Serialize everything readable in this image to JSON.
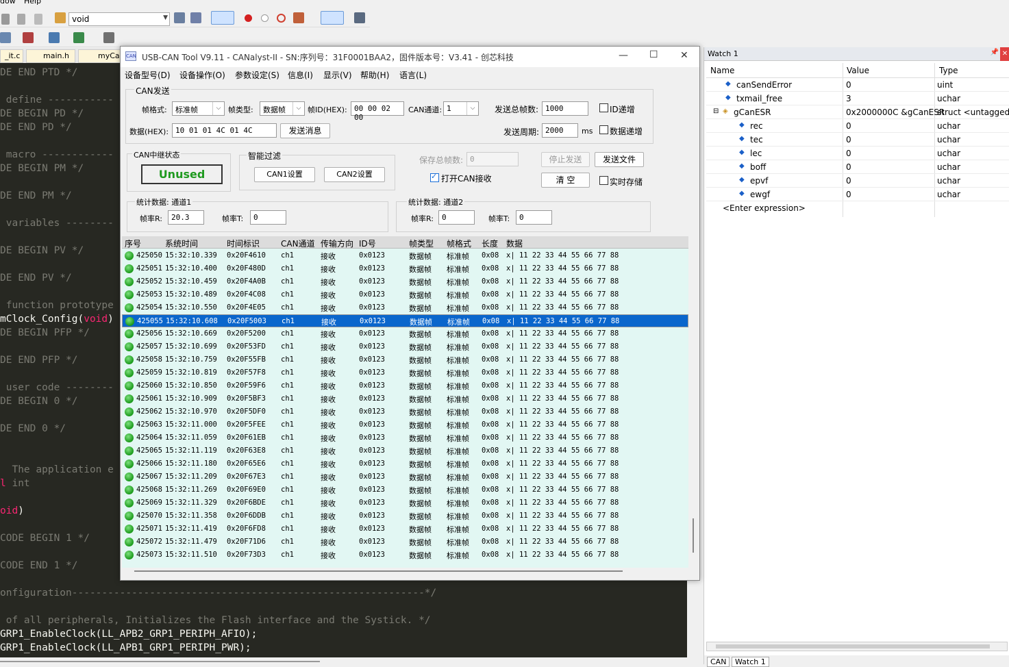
{
  "ide": {
    "menu": [
      "dow",
      "Help"
    ],
    "target_combo": "void",
    "file_tabs": [
      "_it.c",
      "main.h",
      "myCan"
    ],
    "code_lines": [
      {
        "text": "DE END PTD */",
        "hl": false
      },
      {
        "text": "",
        "hl": false
      },
      {
        "text": " define -----------",
        "hl": false
      },
      {
        "text": "DE BEGIN PD */",
        "hl": false
      },
      {
        "text": "DE END PD */",
        "hl": false
      },
      {
        "text": "",
        "hl": false
      },
      {
        "text": " macro ------------",
        "hl": false
      },
      {
        "text": "DE BEGIN PM */",
        "hl": false
      },
      {
        "text": "",
        "hl": false
      },
      {
        "text": "DE END PM */",
        "hl": false
      },
      {
        "text": "",
        "hl": false
      },
      {
        "text": " variables --------",
        "hl": false
      },
      {
        "text": "",
        "hl": false
      },
      {
        "text": "DE BEGIN PV */",
        "hl": false
      },
      {
        "text": "",
        "hl": false
      },
      {
        "text": "DE END PV */",
        "hl": false
      },
      {
        "text": "",
        "hl": false
      },
      {
        "text": " function prototype",
        "hl": false
      },
      {
        "text": "mClock_Config(",
        "hl": true,
        "kw": "void",
        "tail": ")"
      },
      {
        "text": "DE BEGIN PFP */",
        "hl": false
      },
      {
        "text": "",
        "hl": false
      },
      {
        "text": "DE END PFP */",
        "hl": false
      },
      {
        "text": "",
        "hl": false
      },
      {
        "text": " user code --------",
        "hl": false
      },
      {
        "text": "DE BEGIN 0 */",
        "hl": false
      },
      {
        "text": "",
        "hl": false
      },
      {
        "text": "DE END 0 */",
        "hl": false
      },
      {
        "text": "",
        "hl": false
      },
      {
        "text": "",
        "hl": false
      },
      {
        "text": "  The application e",
        "hl": false
      },
      {
        "text": " int",
        "hl": true,
        "kwlead": "l"
      },
      {
        "text": "",
        "hl": false
      },
      {
        "text": ")",
        "hl": true,
        "kwlead": "oid"
      },
      {
        "text": "",
        "hl": false
      },
      {
        "text": "CODE BEGIN 1 */",
        "hl": false
      },
      {
        "text": "",
        "hl": false
      },
      {
        "text": "CODE END 1 */",
        "hl": false
      },
      {
        "text": "",
        "hl": false
      },
      {
        "text": "onfiguration-----------------------------------------------------------*/",
        "hl": false
      },
      {
        "text": "",
        "hl": false
      },
      {
        "text": " of all peripherals, Initializes the Flash interface and the Systick. */",
        "hl": false
      },
      {
        "text": "GRP1_EnableClock(LL_APB2_GRP1_PERIPH_AFIO);",
        "hl": true
      },
      {
        "text": "GRP1_EnableClock(LL_APB1_GRP1_PERIPH_PWR);",
        "hl": true
      }
    ]
  },
  "dialog": {
    "icon_text": "CAN",
    "title": "USB-CAN Tool V9.11 - CANalyst-II - SN:序列号：31F0001BAA2，固件版本号：V3.41 - 创芯科技",
    "menu": [
      "设备型号(D)",
      "设备操作(O)",
      "参数设定(S)",
      "信息(I)",
      "显示(V)",
      "帮助(H)",
      "语言(L)"
    ],
    "send": {
      "group_label": "CAN发送",
      "frame_format_label": "帧格式:",
      "frame_format": "标准帧",
      "frame_type_label": "帧类型:",
      "frame_type": "数据帧",
      "frame_id_label": "帧ID(HEX):",
      "frame_id": "00 00 02 00",
      "channel_label": "CAN通道:",
      "channel": "1",
      "total_label": "发送总帧数:",
      "total": "1000",
      "id_inc_label": "ID递增",
      "data_label": "数据(HEX):",
      "data": "10 01 01 4C 01 4C",
      "send_button": "发送消息",
      "period_label": "发送周期:",
      "period": "2000",
      "period_unit": "ms",
      "data_inc_label": "数据递增"
    },
    "relay": {
      "label": "CAN中继状态",
      "status": "Unused"
    },
    "filter": {
      "label": "智能过滤",
      "can1": "CAN1设置",
      "can2": "CAN2设置"
    },
    "save_total_label": "保存总帧数:",
    "save_total": "0",
    "stop_button": "停止发送",
    "send_file_button": "发送文件",
    "open_recv_label": "打开CAN接收",
    "clear_button": "清 空",
    "realtime_save_label": "实时存储",
    "stats1": {
      "label": "统计数据: 通道1",
      "rate_r_label": "帧率R:",
      "rate_r": "20.3",
      "rate_t_label": "帧率T:",
      "rate_t": "0"
    },
    "stats2": {
      "label": "统计数据: 通道2",
      "rate_r_label": "帧率R:",
      "rate_r": "0",
      "rate_t_label": "帧率T:",
      "rate_t": "0"
    },
    "table": {
      "headers": [
        "序号",
        "系统时间",
        "时间标识",
        "CAN通道",
        "传输方向",
        "ID号",
        "帧类型",
        "帧格式",
        "长度",
        "数据"
      ],
      "rows": [
        [
          "425050",
          "15:32:10.339",
          "0x20F4610",
          "ch1",
          "接收",
          "0x0123",
          "数据帧",
          "标准帧",
          "0x08",
          "x| 11 22 33 44 55 66 77 88"
        ],
        [
          "425051",
          "15:32:10.400",
          "0x20F480D",
          "ch1",
          "接收",
          "0x0123",
          "数据帧",
          "标准帧",
          "0x08",
          "x| 11 22 33 44 55 66 77 88"
        ],
        [
          "425052",
          "15:32:10.459",
          "0x20F4A0B",
          "ch1",
          "接收",
          "0x0123",
          "数据帧",
          "标准帧",
          "0x08",
          "x| 11 22 33 44 55 66 77 88"
        ],
        [
          "425053",
          "15:32:10.489",
          "0x20F4C08",
          "ch1",
          "接收",
          "0x0123",
          "数据帧",
          "标准帧",
          "0x08",
          "x| 11 22 33 44 55 66 77 88"
        ],
        [
          "425054",
          "15:32:10.550",
          "0x20F4E05",
          "ch1",
          "接收",
          "0x0123",
          "数据帧",
          "标准帧",
          "0x08",
          "x| 11 22 33 44 55 66 77 88"
        ],
        [
          "425055",
          "15:32:10.608",
          "0x20F5003",
          "ch1",
          "接收",
          "0x0123",
          "数据帧",
          "标准帧",
          "0x08",
          "x| 11 22 33 44 55 66 77 88"
        ],
        [
          "425056",
          "15:32:10.669",
          "0x20F5200",
          "ch1",
          "接收",
          "0x0123",
          "数据帧",
          "标准帧",
          "0x08",
          "x| 11 22 33 44 55 66 77 88"
        ],
        [
          "425057",
          "15:32:10.699",
          "0x20F53FD",
          "ch1",
          "接收",
          "0x0123",
          "数据帧",
          "标准帧",
          "0x08",
          "x| 11 22 33 44 55 66 77 88"
        ],
        [
          "425058",
          "15:32:10.759",
          "0x20F55FB",
          "ch1",
          "接收",
          "0x0123",
          "数据帧",
          "标准帧",
          "0x08",
          "x| 11 22 33 44 55 66 77 88"
        ],
        [
          "425059",
          "15:32:10.819",
          "0x20F57F8",
          "ch1",
          "接收",
          "0x0123",
          "数据帧",
          "标准帧",
          "0x08",
          "x| 11 22 33 44 55 66 77 88"
        ],
        [
          "425060",
          "15:32:10.850",
          "0x20F59F6",
          "ch1",
          "接收",
          "0x0123",
          "数据帧",
          "标准帧",
          "0x08",
          "x| 11 22 33 44 55 66 77 88"
        ],
        [
          "425061",
          "15:32:10.909",
          "0x20F5BF3",
          "ch1",
          "接收",
          "0x0123",
          "数据帧",
          "标准帧",
          "0x08",
          "x| 11 22 33 44 55 66 77 88"
        ],
        [
          "425062",
          "15:32:10.970",
          "0x20F5DF0",
          "ch1",
          "接收",
          "0x0123",
          "数据帧",
          "标准帧",
          "0x08",
          "x| 11 22 33 44 55 66 77 88"
        ],
        [
          "425063",
          "15:32:11.000",
          "0x20F5FEE",
          "ch1",
          "接收",
          "0x0123",
          "数据帧",
          "标准帧",
          "0x08",
          "x| 11 22 33 44 55 66 77 88"
        ],
        [
          "425064",
          "15:32:11.059",
          "0x20F61EB",
          "ch1",
          "接收",
          "0x0123",
          "数据帧",
          "标准帧",
          "0x08",
          "x| 11 22 33 44 55 66 77 88"
        ],
        [
          "425065",
          "15:32:11.119",
          "0x20F63E8",
          "ch1",
          "接收",
          "0x0123",
          "数据帧",
          "标准帧",
          "0x08",
          "x| 11 22 33 44 55 66 77 88"
        ],
        [
          "425066",
          "15:32:11.180",
          "0x20F65E6",
          "ch1",
          "接收",
          "0x0123",
          "数据帧",
          "标准帧",
          "0x08",
          "x| 11 22 33 44 55 66 77 88"
        ],
        [
          "425067",
          "15:32:11.209",
          "0x20F67E3",
          "ch1",
          "接收",
          "0x0123",
          "数据帧",
          "标准帧",
          "0x08",
          "x| 11 22 33 44 55 66 77 88"
        ],
        [
          "425068",
          "15:32:11.269",
          "0x20F69E0",
          "ch1",
          "接收",
          "0x0123",
          "数据帧",
          "标准帧",
          "0x08",
          "x| 11 22 33 44 55 66 77 88"
        ],
        [
          "425069",
          "15:32:11.329",
          "0x20F6BDE",
          "ch1",
          "接收",
          "0x0123",
          "数据帧",
          "标准帧",
          "0x08",
          "x| 11 22 33 44 55 66 77 88"
        ],
        [
          "425070",
          "15:32:11.358",
          "0x20F6DDB",
          "ch1",
          "接收",
          "0x0123",
          "数据帧",
          "标准帧",
          "0x08",
          "x| 11 22 33 44 55 66 77 88"
        ],
        [
          "425071",
          "15:32:11.419",
          "0x20F6FD8",
          "ch1",
          "接收",
          "0x0123",
          "数据帧",
          "标准帧",
          "0x08",
          "x| 11 22 33 44 55 66 77 88"
        ],
        [
          "425072",
          "15:32:11.479",
          "0x20F71D6",
          "ch1",
          "接收",
          "0x0123",
          "数据帧",
          "标准帧",
          "0x08",
          "x| 11 22 33 44 55 66 77 88"
        ],
        [
          "425073",
          "15:32:11.510",
          "0x20F73D3",
          "ch1",
          "接收",
          "0x0123",
          "数据帧",
          "标准帧",
          "0x08",
          "x| 11 22 33 44 55 66 77 88"
        ]
      ],
      "selected_row": 5
    }
  },
  "watch": {
    "title": "Watch 1",
    "headers": {
      "name": "Name",
      "value": "Value",
      "type": "Type"
    },
    "rows": [
      {
        "name": "canSendError",
        "value": "0",
        "type": "uint",
        "indent": 1
      },
      {
        "name": "txmail_free",
        "value": "3",
        "type": "uchar",
        "indent": 1
      },
      {
        "name": "gCanESR",
        "value": "0x2000000C &gCanESR",
        "type": "struct <untagged>",
        "indent": 0
      },
      {
        "name": "rec",
        "value": "0",
        "type": "uchar",
        "indent": 2
      },
      {
        "name": "tec",
        "value": "0",
        "type": "uchar",
        "indent": 2
      },
      {
        "name": "lec",
        "value": "0",
        "type": "uchar",
        "indent": 2
      },
      {
        "name": "boff",
        "value": "0",
        "type": "uchar",
        "indent": 2
      },
      {
        "name": "epvf",
        "value": "0",
        "type": "uchar",
        "indent": 2
      },
      {
        "name": "ewgf",
        "value": "0",
        "type": "uchar",
        "indent": 2
      }
    ],
    "enter_expression": "<Enter expression>",
    "bottom_tabs": [
      "CAN",
      "Watch 1"
    ]
  }
}
